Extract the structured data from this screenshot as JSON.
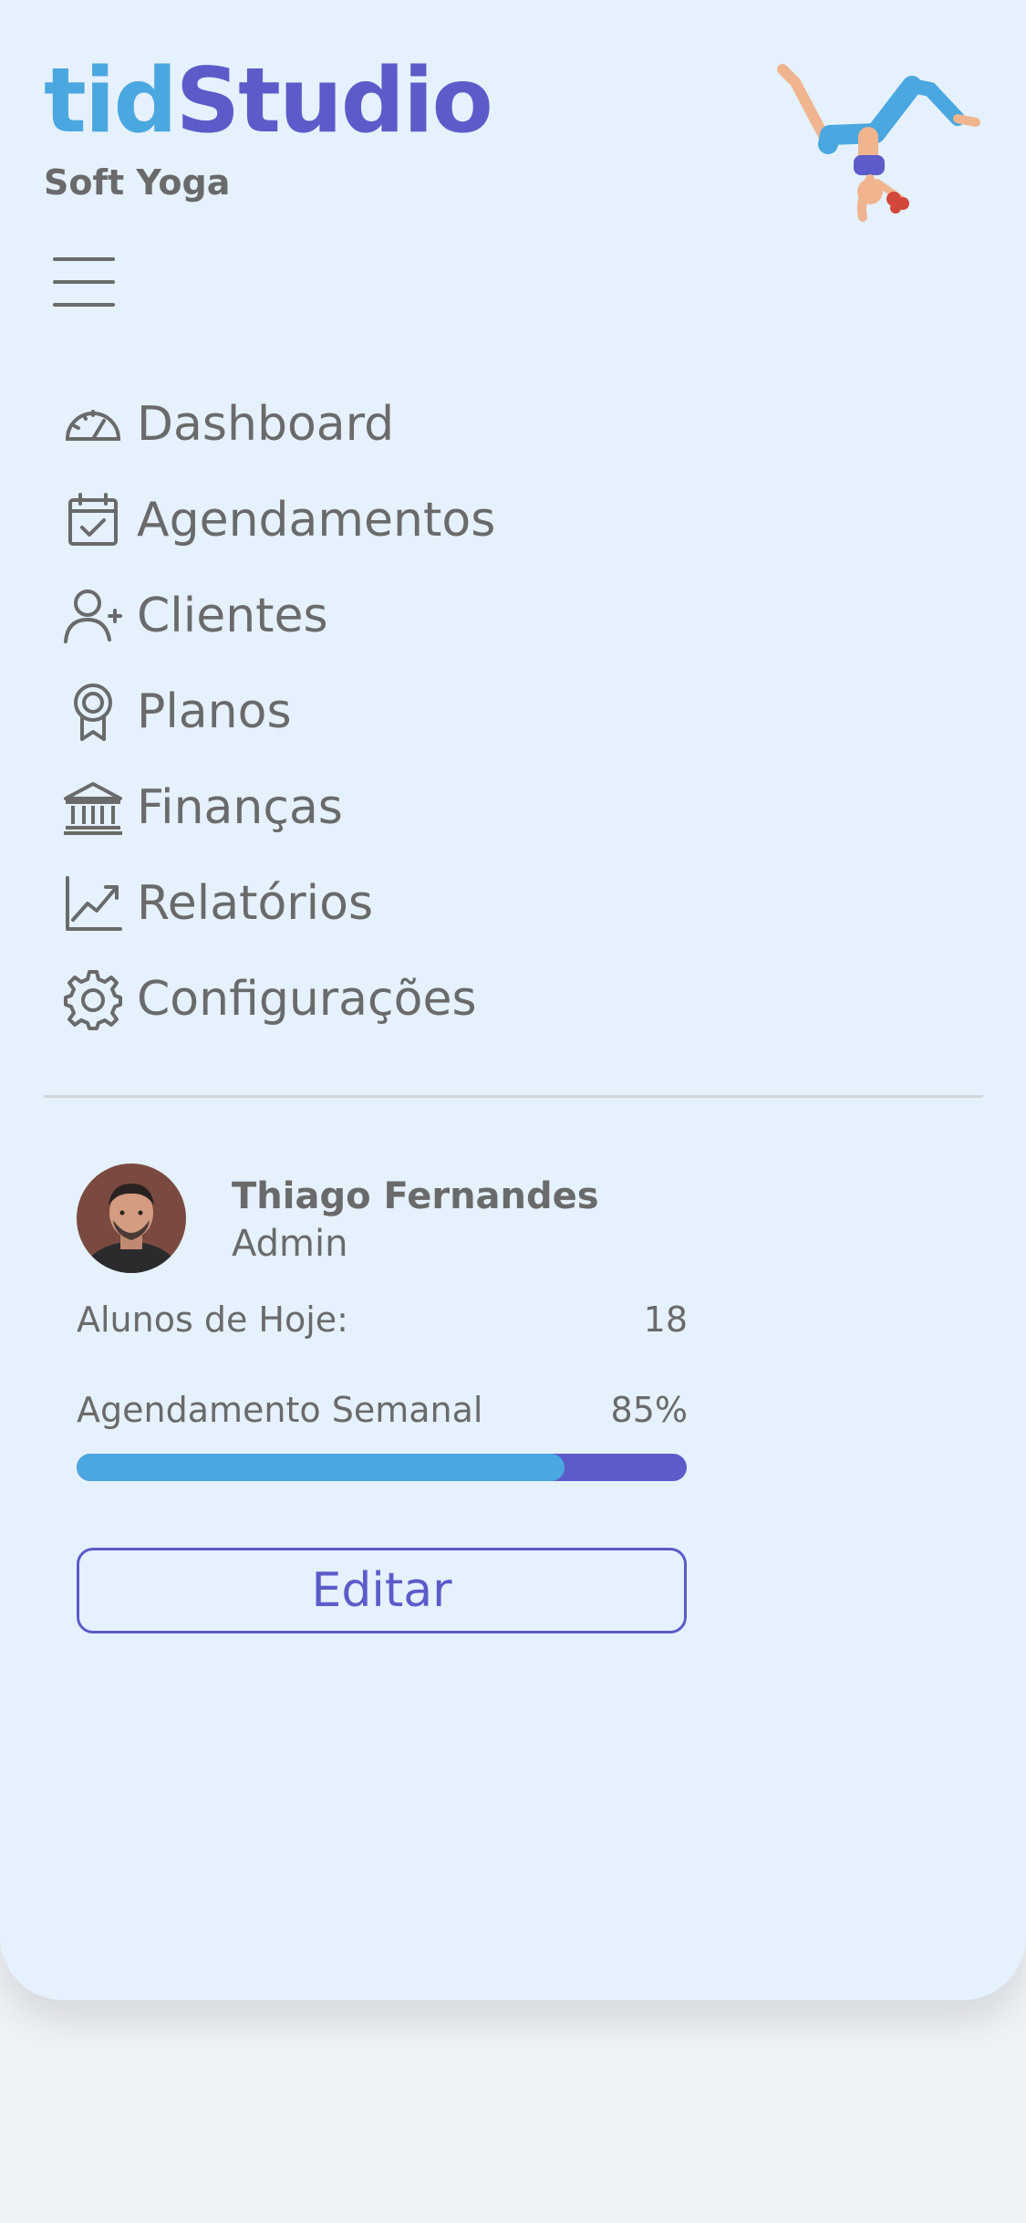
{
  "brand": {
    "logo_part1": "tid",
    "logo_part2": "Studio",
    "subtitle": "Soft Yoga"
  },
  "colors": {
    "accent_blue": "#4aa7e0",
    "accent_purple": "#5b5cc9",
    "panel_bg": "#e5f1fc",
    "text": "#6a6a6a"
  },
  "nav": {
    "items": [
      {
        "label": "Dashboard",
        "icon": "gauge-icon"
      },
      {
        "label": "Agendamentos",
        "icon": "calendar-check-icon"
      },
      {
        "label": "Clientes",
        "icon": "user-plus-icon"
      },
      {
        "label": "Planos",
        "icon": "award-icon"
      },
      {
        "label": "Finanças",
        "icon": "bank-icon"
      },
      {
        "label": "Relatórios",
        "icon": "chart-line-icon"
      },
      {
        "label": "Configurações",
        "icon": "gear-icon"
      }
    ]
  },
  "user": {
    "name": "Thiago Fernandes",
    "role": "Admin",
    "students_label": "Alunos de Hoje:",
    "students_value": "18",
    "weekly_label": "Agendamento Semanal",
    "weekly_value": "85%",
    "weekly_fraction": 0.8
  },
  "actions": {
    "edit_label": "Editar"
  }
}
